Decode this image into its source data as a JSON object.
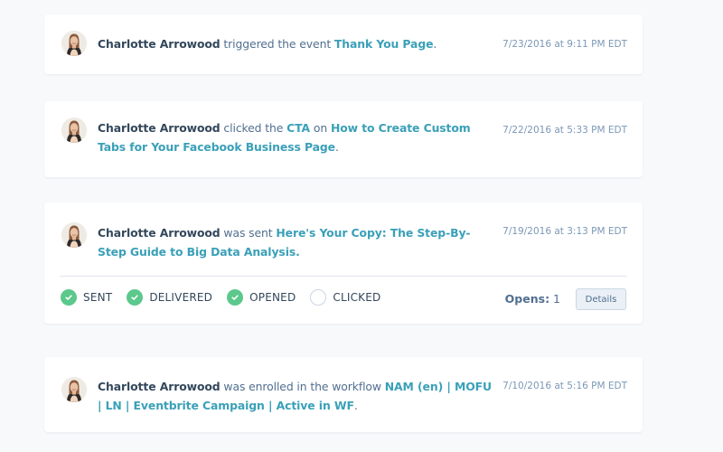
{
  "colors": {
    "background": "#f7f9fb",
    "card": "#ffffff",
    "name": "#33475b",
    "verb": "#516f90",
    "link": "#3aa0b8",
    "timestamp": "#7c98b6",
    "status_done": "#5cc88c",
    "status_pending_border": "#cbd6e2"
  },
  "events": [
    {
      "contact": "Charlotte Arrowood",
      "avatar_icon": "contact-avatar",
      "verb": " triggered the event ",
      "link": "Thank You Page",
      "suffix": ".",
      "timestamp": "7/23/2016 at 9:11 PM EDT"
    },
    {
      "contact": "Charlotte Arrowood",
      "avatar_icon": "contact-avatar",
      "verb": " clicked the ",
      "link_cta": "CTA",
      "verb2": " on ",
      "link": "How to Create Custom Tabs for Your Facebook Business Page",
      "suffix": ".",
      "timestamp": "7/22/2016 at 5:33 PM EDT"
    },
    {
      "contact": "Charlotte Arrowood",
      "avatar_icon": "contact-avatar",
      "verb": " was sent ",
      "link": "Here's Your Copy: The Step-By-Step Guide to Big Data Analysis.",
      "suffix": "",
      "timestamp": "7/19/2016 at 3:13 PM EDT",
      "statuses": [
        {
          "label": "SENT",
          "done": true,
          "icon": "check-circle-icon"
        },
        {
          "label": "DELIVERED",
          "done": true,
          "icon": "check-circle-icon"
        },
        {
          "label": "OPENED",
          "done": true,
          "icon": "check-circle-icon"
        },
        {
          "label": "CLICKED",
          "done": false,
          "icon": "empty-circle-icon"
        }
      ],
      "opens_label": "Opens:",
      "opens_value": "1",
      "details_label": "Details"
    },
    {
      "contact": "Charlotte Arrowood",
      "avatar_icon": "contact-avatar",
      "verb": " was enrolled in the workflow ",
      "link": "NAM (en) | MOFU | LN | Eventbrite Campaign | Active in WF",
      "suffix": ".",
      "timestamp": "7/10/2016 at 5:16 PM EDT"
    }
  ]
}
